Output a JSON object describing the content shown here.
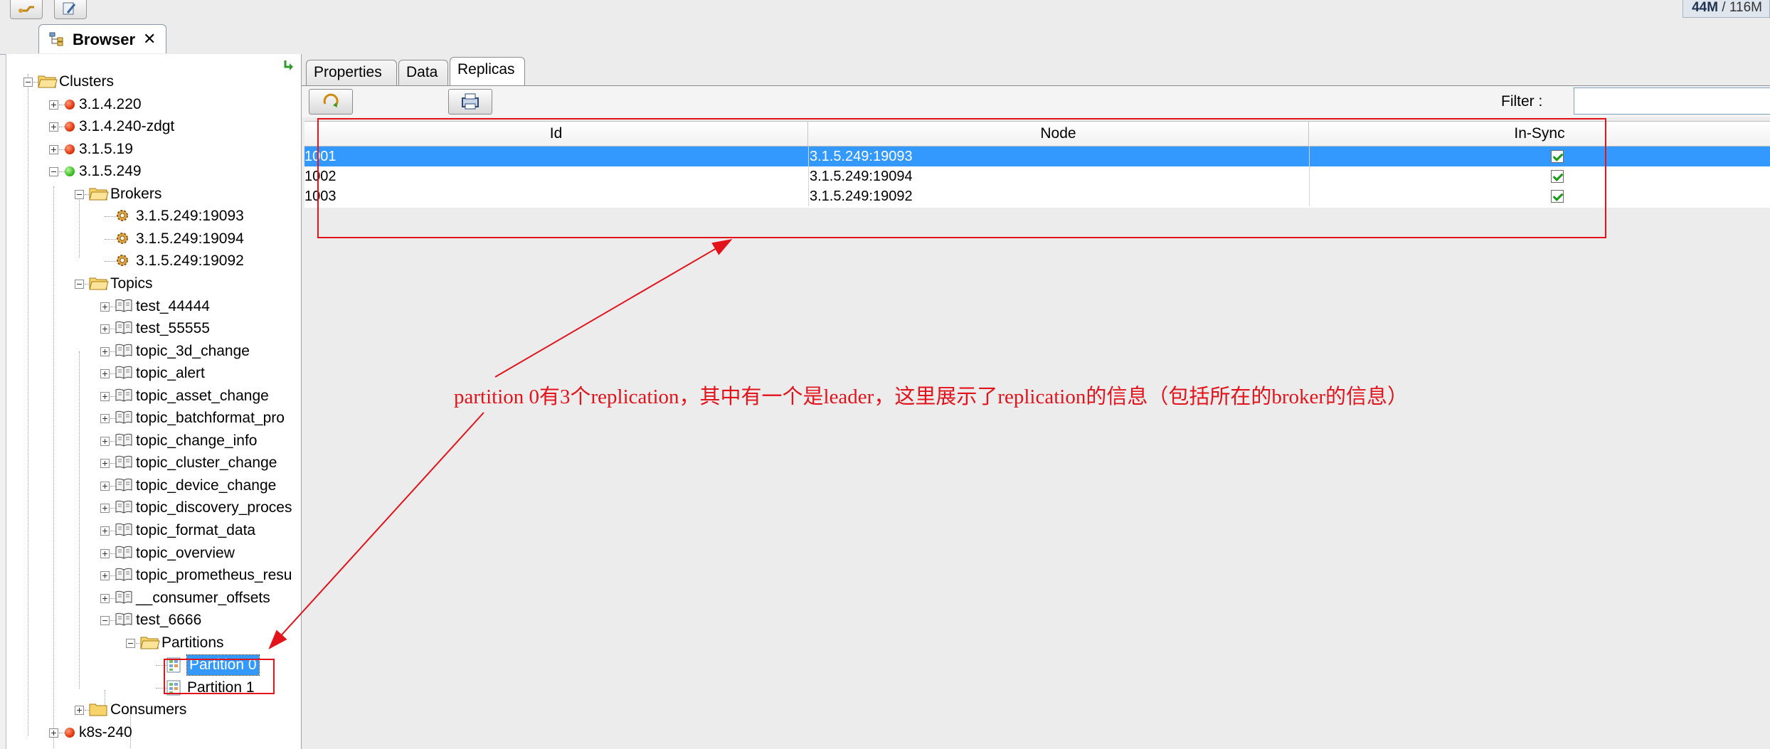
{
  "window": {
    "memory_used": "44M",
    "memory_total": "116M",
    "browser_tab_label": "Browser",
    "close_glyph": "✕"
  },
  "tree": {
    "clusters_label": "Clusters",
    "clusters": [
      {
        "label": "3.1.4.220",
        "status": "red"
      },
      {
        "label": "3.1.4.240-zdgt",
        "status": "red"
      },
      {
        "label": "3.1.5.19",
        "status": "red"
      },
      {
        "label": "3.1.5.249",
        "status": "green"
      }
    ],
    "brokers_label": "Brokers",
    "brokers": [
      "3.1.5.249:19093",
      "3.1.5.249:19094",
      "3.1.5.249:19092"
    ],
    "topics_label": "Topics",
    "topics": [
      "test_44444",
      "test_55555",
      "topic_3d_change",
      "topic_alert",
      "topic_asset_change",
      "topic_batchformat_pro",
      "topic_change_info",
      "topic_cluster_change",
      "topic_device_change",
      "topic_discovery_proces",
      "topic_format_data",
      "topic_overview",
      "topic_prometheus_resu",
      "__consumer_offsets",
      "test_6666"
    ],
    "partitions_label": "Partitions",
    "partitions": [
      "Partition 0",
      "Partition 1"
    ],
    "consumers_label": "Consumers",
    "last_cluster": {
      "label": "k8s-240",
      "status": "red"
    }
  },
  "detail": {
    "tabs": [
      {
        "label": "Properties",
        "active": false
      },
      {
        "label": "Data",
        "active": false
      },
      {
        "label": "Replicas",
        "active": true
      }
    ],
    "filter_label": "Filter :",
    "filter_value": "",
    "columns": [
      "Id",
      "Node",
      "In-Sync"
    ],
    "rows": [
      {
        "id": "1001",
        "node": "3.1.5.249:19093",
        "in_sync": true,
        "selected": true
      },
      {
        "id": "1002",
        "node": "3.1.5.249:19094",
        "in_sync": true,
        "selected": false
      },
      {
        "id": "1003",
        "node": "3.1.5.249:19092",
        "in_sync": true,
        "selected": false
      }
    ]
  },
  "annotation": {
    "text": "partition 0有3个replication，其中有一个是leader，这里展示了replication的信息（包括所在的broker的信息）",
    "color": "#e3131b"
  }
}
